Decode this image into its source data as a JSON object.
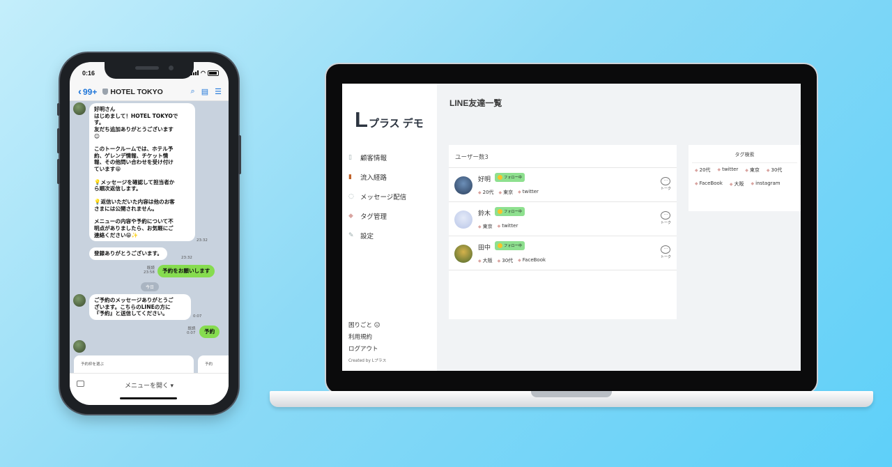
{
  "phone": {
    "status": {
      "time": "0:16"
    },
    "header": {
      "back_label": "99+",
      "title": "HOTEL TOKYO"
    },
    "messages": [
      {
        "lines": [
          "好明さん",
          "はじめまして！HOTEL TOKYOで",
          "す。",
          "友だち追加ありがとうございます",
          "☺",
          "",
          "このトークルームでは、ホテル予",
          "約、ゲレンデ情報、チケット情",
          "報、その他問い合わせを受け付け",
          "ています😁",
          "",
          "💡メッセージを確認して担当者か",
          "ら順次返信します。",
          "",
          "💡返信いただいた内容は他のお客",
          "さまには公開されません。",
          "",
          "メニューの内容や予約について不",
          "明点がありましたら、お気軽にご",
          "連絡ください😁✨"
        ],
        "time": "23:32"
      },
      {
        "text": "登録ありがとうございます。",
        "time": "23:32"
      },
      {
        "text": "予約をお願いします",
        "read": "既読",
        "time": "23:58"
      },
      {
        "lines": [
          "ご予約のメッセージありがとうご",
          "ざいます。こちらのLINEの方に",
          "『予約』と送信してください。"
        ],
        "time": "0:07"
      },
      {
        "text": "予約",
        "read": "既読",
        "time": "0:07"
      }
    ],
    "date_chip": "今日",
    "cards": [
      {
        "label": "予約枠を選ぶ"
      },
      {
        "label": "予約"
      }
    ],
    "footer": {
      "menu_label": "メニューを開く ▾"
    }
  },
  "app": {
    "logo_l": "L",
    "logo_rest": "プラス デモ",
    "nav": [
      {
        "label": "顧客情報",
        "icon": "document-icon"
      },
      {
        "label": "流入経路",
        "icon": "door-icon"
      },
      {
        "label": "メッセージ配信",
        "icon": "chat-icon"
      },
      {
        "label": "タグ管理",
        "icon": "tag-icon"
      },
      {
        "label": "設定",
        "icon": "wrench-icon"
      }
    ],
    "bottom": {
      "help": "困りごと 😐",
      "terms": "利用規約",
      "logout": "ログアウト",
      "created": "Created by Lプラス"
    },
    "page_title": "LINE友達一覧",
    "user_count": "ユーザー数3",
    "follow_label": "フォロー中",
    "talk_label": "トーク",
    "users": [
      {
        "name": "好明",
        "tags": [
          "20代",
          "東京",
          "twitter"
        ]
      },
      {
        "name": "鈴木",
        "tags": [
          "東京",
          "twitter"
        ]
      },
      {
        "name": "田中",
        "tags": [
          "大阪",
          "30代",
          "FaceBook"
        ]
      }
    ],
    "tag_search": {
      "title": "タグ検索",
      "tags": [
        "20代",
        "twitter",
        "東京",
        "30代",
        "FaceBook",
        "大阪",
        "instagram"
      ]
    }
  },
  "colors": {
    "line_green": "#86dc4f",
    "chat_bg": "#c8d2de",
    "follow_badge": "#8ee08f",
    "ios_blue": "#1e76d9"
  }
}
